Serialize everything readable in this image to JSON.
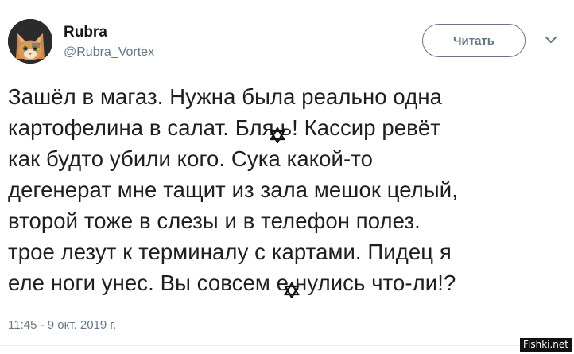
{
  "user": {
    "name": "Rubra",
    "handle": "@Rubra_Vortex"
  },
  "actions": {
    "follow_label": "Читать"
  },
  "tweet": {
    "lines": [
      [
        "Зашёл в магаз. Нужна была реально одна"
      ],
      [
        "картофелина в салат. Бля",
        "ь! Кассир ревёт"
      ],
      [
        "как будто убили кого. Сука какой-то"
      ],
      [
        "дегенерат мне тащит из зала мешок целый,"
      ],
      [
        "второй тоже в слезы и в телефон полез."
      ],
      [
        "трое лезут к терминалу с картами. Пидец я"
      ],
      [
        "еле ноги унес. Вы совсем е",
        "нулись что-ли!?"
      ]
    ],
    "timestamp": "11:45 - 9 окт. 2019 г."
  },
  "watermark": "Fishki.net",
  "colors": {
    "text": "#1c2022",
    "secondary": "#657786",
    "divider": "#e6ecf0"
  },
  "icons": {
    "avatar": "cat-avatar",
    "menu": "chevron-down-icon",
    "censor": "star-of-david-icon"
  }
}
